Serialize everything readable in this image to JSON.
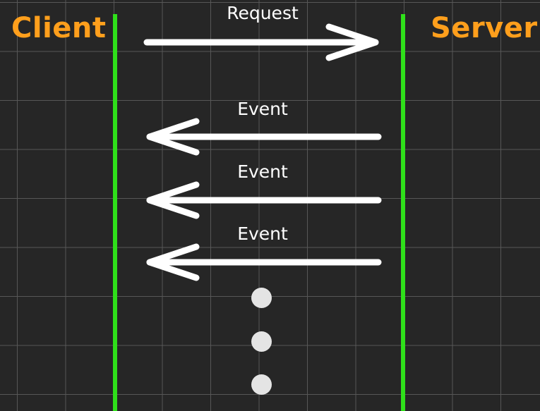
{
  "diagram": {
    "participants": [
      {
        "id": "client",
        "label": "Client"
      },
      {
        "id": "server",
        "label": "Server"
      }
    ],
    "messages": [
      {
        "from": "client",
        "to": "server",
        "label": "Request"
      },
      {
        "from": "server",
        "to": "client",
        "label": "Event"
      },
      {
        "from": "server",
        "to": "client",
        "label": "Event"
      },
      {
        "from": "server",
        "to": "client",
        "label": "Event"
      }
    ],
    "continuation_dots": 3
  },
  "colors": {
    "background": "#262626",
    "grid": "#575757",
    "lifeline": "#2fe01a",
    "participant_label": "#ff9f1c",
    "arrow": "#ffffff",
    "dot": "#e4e4e4"
  }
}
